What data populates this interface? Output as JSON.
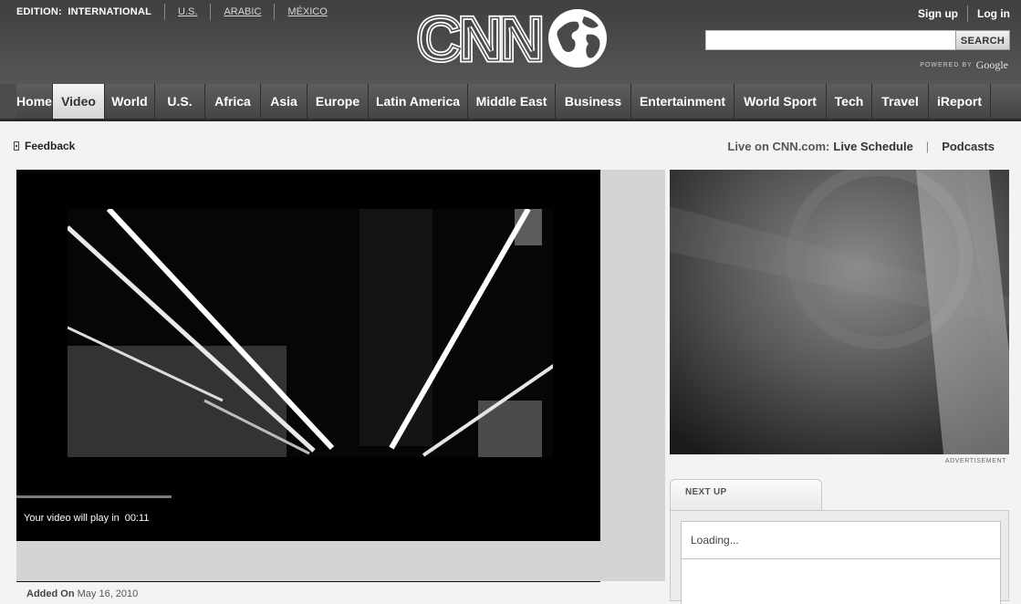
{
  "header": {
    "edition_label": "EDITION:",
    "edition_value": "INTERNATIONAL",
    "edition_links": [
      "U.S.",
      "ARABIC",
      "MÉXICO"
    ],
    "logo_text": "CNN",
    "signup": "Sign up",
    "login": "Log in",
    "search": {
      "placeholder": "",
      "button": "SEARCH"
    },
    "powered_by": "POWERED BY",
    "powered_brand": "Google"
  },
  "nav": {
    "items": [
      "Home",
      "Video",
      "World",
      "U.S.",
      "Africa",
      "Asia",
      "Europe",
      "Latin America",
      "Middle East",
      "Business",
      "Entertainment",
      "World Sport",
      "Tech",
      "Travel",
      "iReport"
    ],
    "active": "Video"
  },
  "subbar": {
    "feedback": "Feedback",
    "live_prefix": "Live on CNN.com:",
    "live_schedule": "Live Schedule",
    "podcasts": "Podcasts"
  },
  "video": {
    "countdown_label": "Your video will play in",
    "countdown_time": "00:11",
    "added_label": "Added On",
    "added_date": "May 16, 2010"
  },
  "sidebar": {
    "ad_label": "ADVERTISEMENT",
    "next_up_label": "NEXT UP",
    "loading_text": "Loading..."
  },
  "colors": {
    "header_bg": "#4f4f4f",
    "nav_bg": "#4f4f4f",
    "page_bg": "#f3f3f3",
    "video_bg": "#000000"
  }
}
